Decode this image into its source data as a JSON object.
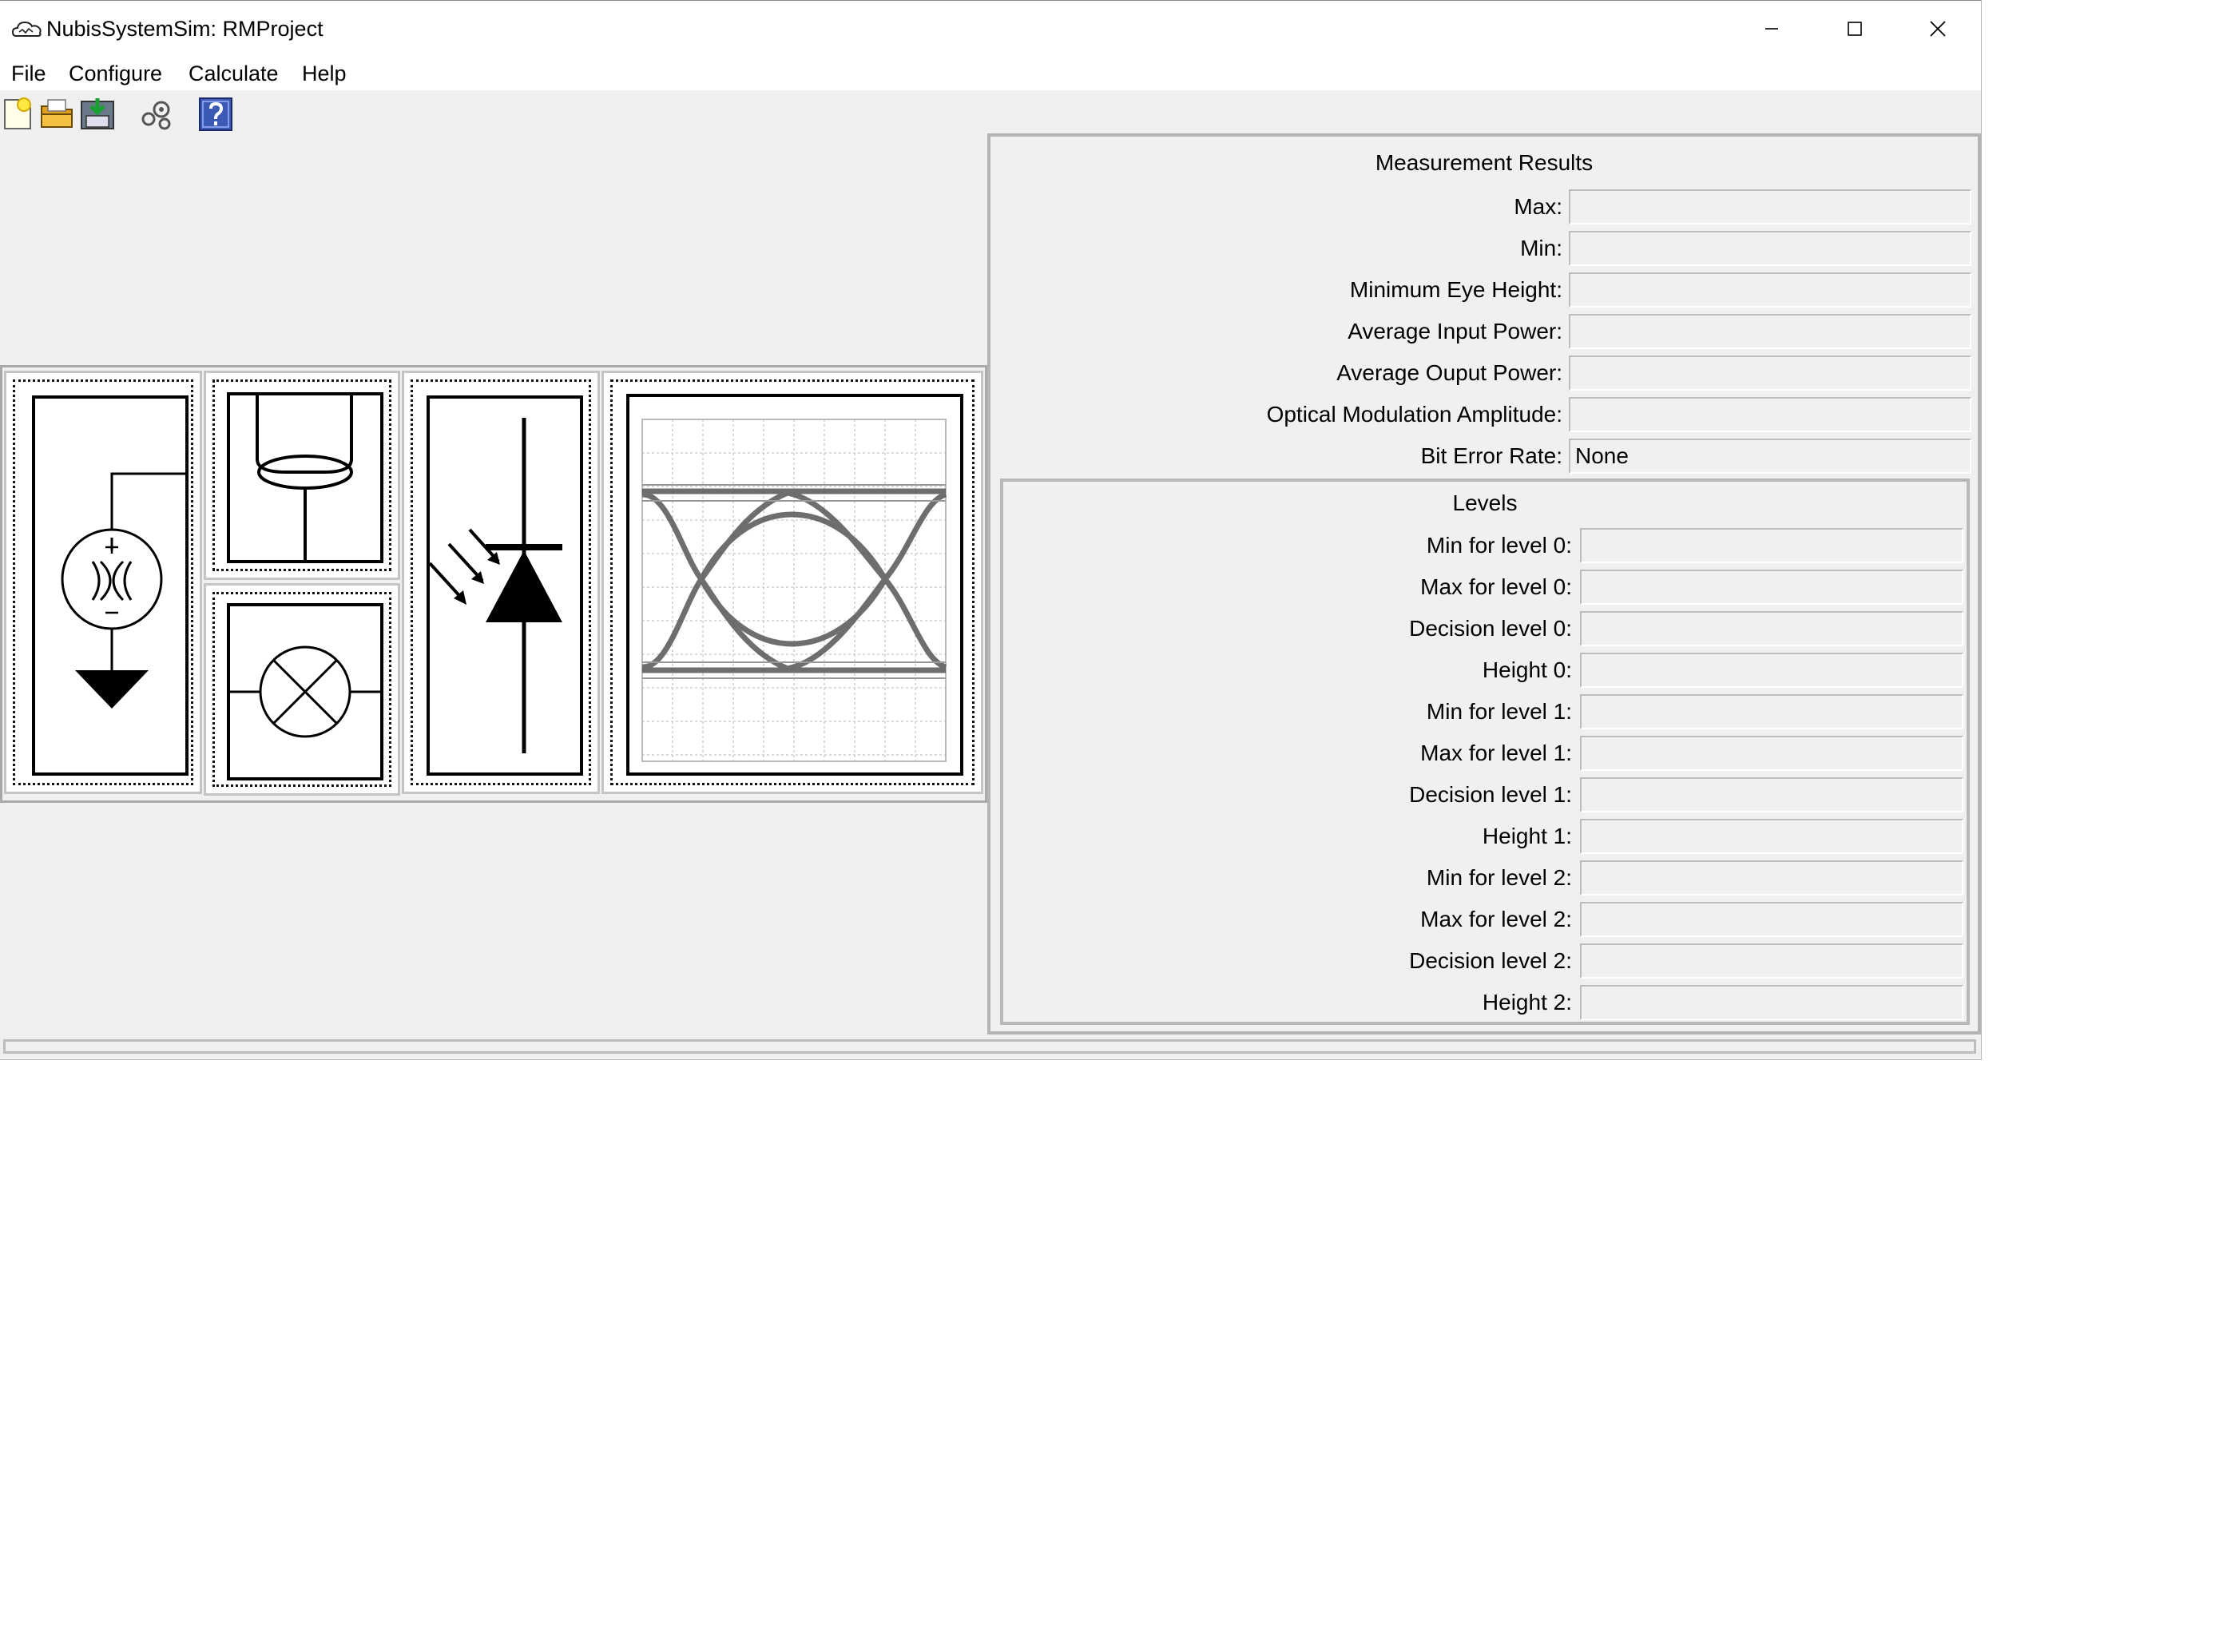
{
  "window": {
    "title": "NubisSystemSim: RMProject",
    "controls": [
      "minimize",
      "maximize",
      "close"
    ]
  },
  "menu": [
    "File",
    "Configure",
    "Calculate",
    "Help"
  ],
  "toolbar": {
    "icons": [
      "new-file-icon",
      "open-folder-icon",
      "save-icon",
      "run-calculation-icon",
      "help-icon"
    ]
  },
  "diagram": {
    "blocks": [
      "signal-source",
      "fiber",
      "modulator-lamp",
      "photodiode",
      "eye-diagram"
    ]
  },
  "results": {
    "title": "Measurement Results",
    "rows": [
      {
        "label": "Max:",
        "value": ""
      },
      {
        "label": "Min:",
        "value": ""
      },
      {
        "label": "Minimum Eye Height:",
        "value": ""
      },
      {
        "label": "Average Input Power:",
        "value": ""
      },
      {
        "label": "Average Ouput Power:",
        "value": ""
      },
      {
        "label": "Optical Modulation Amplitude:",
        "value": ""
      },
      {
        "label": "Bit Error Rate:",
        "value": "None"
      }
    ]
  },
  "levels": {
    "title": "Levels",
    "rows": [
      {
        "label": "Min for level 0:",
        "value": ""
      },
      {
        "label": "Max for level 0:",
        "value": ""
      },
      {
        "label": "Decision level 0:",
        "value": ""
      },
      {
        "label": "Height 0:",
        "value": ""
      },
      {
        "label": "Min for level 1:",
        "value": ""
      },
      {
        "label": "Max for level 1:",
        "value": ""
      },
      {
        "label": "Decision level 1:",
        "value": ""
      },
      {
        "label": "Height 1:",
        "value": ""
      },
      {
        "label": "Min for level 2:",
        "value": ""
      },
      {
        "label": "Max for level 2:",
        "value": ""
      },
      {
        "label": "Decision level 2:",
        "value": ""
      },
      {
        "label": "Height 2:",
        "value": ""
      }
    ]
  }
}
